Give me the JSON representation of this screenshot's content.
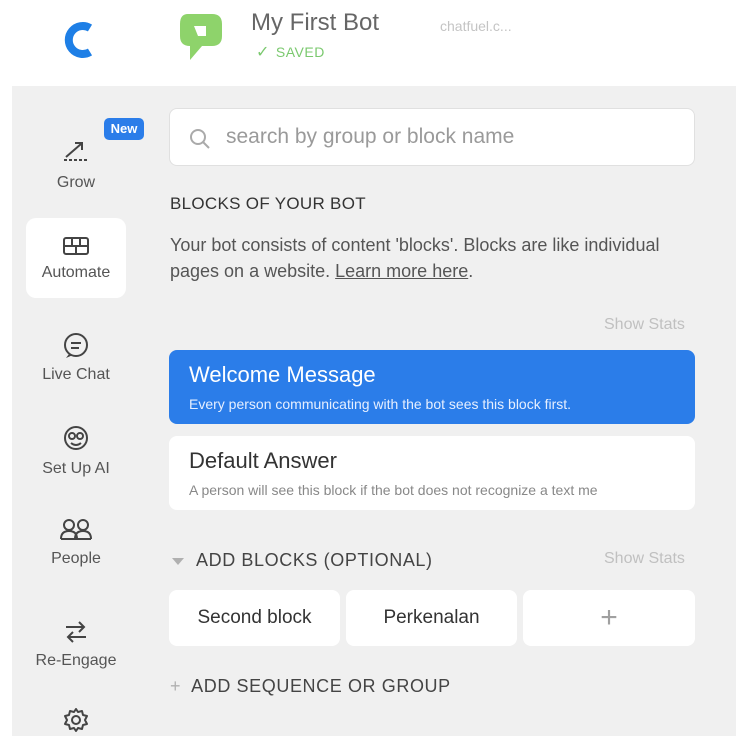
{
  "header": {
    "bot_name": "My First Bot",
    "status": "SAVED",
    "url": "chatfuel.c..."
  },
  "sidebar": {
    "new_badge": "New",
    "items": [
      {
        "label": "Grow",
        "icon": "grow-icon"
      },
      {
        "label": "Automate",
        "icon": "automate-icon",
        "active": true
      },
      {
        "label": "Live Chat",
        "icon": "live-chat-icon"
      },
      {
        "label": "Set Up AI",
        "icon": "ai-icon"
      },
      {
        "label": "People",
        "icon": "people-icon"
      },
      {
        "label": "Re-Engage",
        "icon": "re-engage-icon"
      },
      {
        "label": "",
        "icon": "gear-icon"
      }
    ]
  },
  "search": {
    "placeholder": "search by group or block name"
  },
  "main": {
    "section_title": "BLOCKS OF YOUR BOT",
    "description": "Your bot consists of content 'blocks'. Blocks are like individual pages on a website.",
    "learn_more": "Learn more here",
    "desc_end": ".",
    "show_stats": "Show Stats",
    "blocks": [
      {
        "title": "Welcome Message",
        "subtitle": "Every person communicating with the bot sees this block first."
      },
      {
        "title": "Default Answer",
        "subtitle": "A person will see this block if the bot does not recognize a text me"
      }
    ],
    "add_blocks_label": "ADD BLOCKS (OPTIONAL)",
    "chips": [
      "Second block",
      "Perkenalan",
      "+"
    ],
    "add_sequence_label": "ADD SEQUENCE OR GROUP"
  },
  "colors": {
    "accent": "#2b7de9",
    "saved": "#7bc96f",
    "background": "#f0f0f0"
  }
}
